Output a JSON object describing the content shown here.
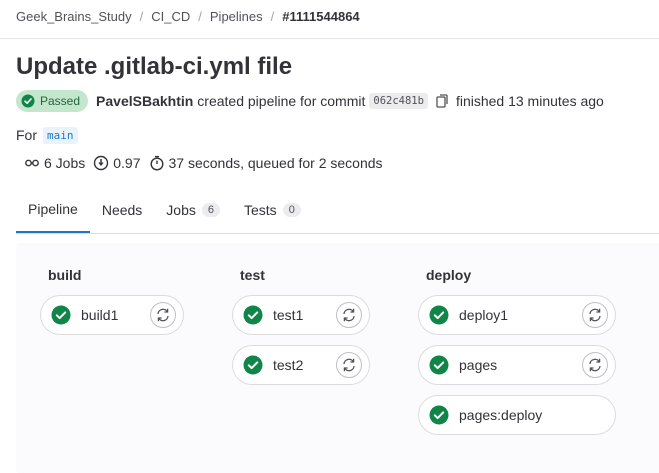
{
  "breadcrumb": [
    "Geek_Brains_Study",
    "CI_CD",
    "Pipelines",
    "#1111544864"
  ],
  "pipeline": {
    "title": "Update .gitlab-ci.yml file",
    "status": "Passed",
    "author": "PavelSBakhtin",
    "created_text": "created pipeline for commit",
    "commit": "062c481b",
    "finished_text": "finished 13 minutes ago",
    "for_label": "For",
    "branch": "main",
    "jobs_count": "6 Jobs",
    "version": "0.97",
    "duration": "37 seconds, queued for 2 seconds"
  },
  "tabs": [
    {
      "label": "Pipeline"
    },
    {
      "label": "Needs"
    },
    {
      "label": "Jobs",
      "count": "6"
    },
    {
      "label": "Tests",
      "count": "0"
    }
  ],
  "stages": [
    {
      "name": "build",
      "jobs": [
        {
          "name": "build1",
          "retry": true
        }
      ]
    },
    {
      "name": "test",
      "jobs": [
        {
          "name": "test1",
          "retry": true
        },
        {
          "name": "test2",
          "retry": true
        }
      ]
    },
    {
      "name": "deploy",
      "jobs": [
        {
          "name": "deploy1",
          "retry": true
        },
        {
          "name": "pages",
          "retry": true
        },
        {
          "name": "pages:deploy",
          "retry": false
        }
      ]
    }
  ],
  "colors": {
    "success": "#108548",
    "accent": "#1f75cb",
    "passed_bg": "#c3e6cd"
  },
  "icons": {
    "status": "check-circle-icon",
    "retry": "retry-icon",
    "copy": "copy-icon",
    "jobs": "pipeline-icon",
    "version": "info-circle-icon",
    "duration": "timer-icon"
  }
}
